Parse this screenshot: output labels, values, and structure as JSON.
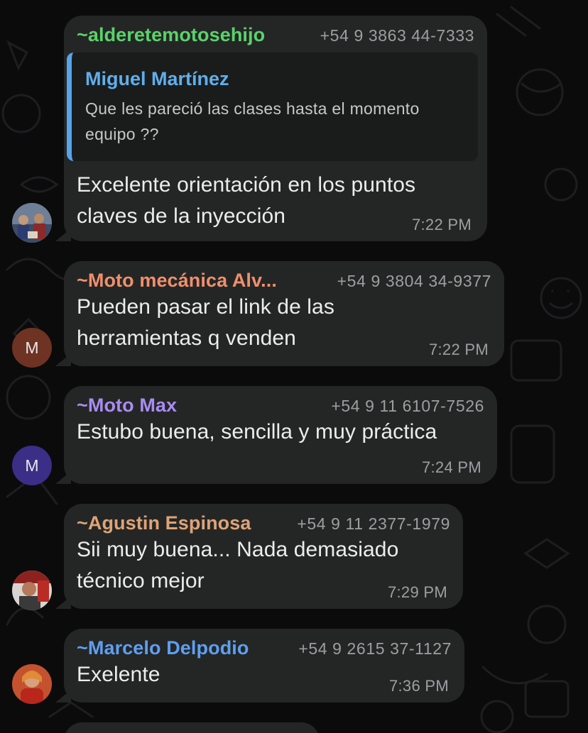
{
  "colors": {
    "background": "#0b0b0c",
    "bubble": "#242626",
    "meta_text": "#9c9fa1"
  },
  "messages": [
    {
      "sender": "~alderetemotosehijo",
      "sender_color": "#5bd26a",
      "phone": "+54 9 3863 44-7333",
      "reply": {
        "author": "Miguel Martínez",
        "text_line1": "Que les pareció las clases hasta el momento",
        "text_line2": "equipo ??"
      },
      "text_line1": "Excelente orientación en los puntos",
      "text_line2": "claves de la inyección",
      "time": "7:22 PM",
      "avatar": "photo"
    },
    {
      "sender": "~Moto mecánica Alv...",
      "sender_color": "#f18f6c",
      "phone": "+54 9 3804 34-9377",
      "text_line1": "Pueden pasar el link de las",
      "text_line2": "herramientas q venden",
      "time": "7:22 PM",
      "avatar_letter": "M",
      "avatar_color": "#6e3322"
    },
    {
      "sender": "~Moto Max",
      "sender_color": "#a98cf0",
      "phone": "+54 9 11 6107-7526",
      "text_line1": "Estubo buena, sencilla y muy práctica",
      "time": "7:24 PM",
      "avatar_letter": "M",
      "avatar_color": "#3b2e86"
    },
    {
      "sender": "~Agustin Espinosa",
      "sender_color": "#dfa376",
      "phone": "+54 9 11 2377-1979",
      "text_line1": "Sii muy buena... Nada demasiado",
      "text_line2": "técnico mejor",
      "time": "7:29 PM",
      "avatar": "photo"
    },
    {
      "sender": "~Marcelo Delpodio",
      "sender_color": "#5e9ff0",
      "phone": "+54 9 2615 37-1127",
      "text_line1": "Exelente",
      "time": "7:36 PM",
      "avatar": "photo"
    }
  ]
}
